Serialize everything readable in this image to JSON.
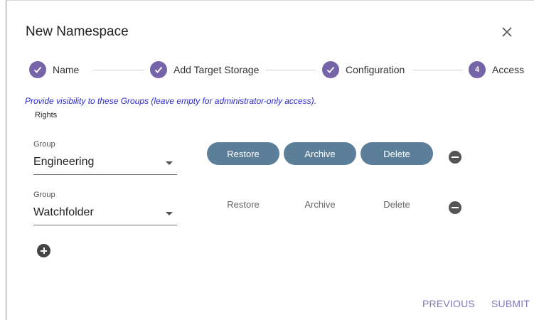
{
  "dialog": {
    "title": "New Namespace",
    "close_icon": "close-icon"
  },
  "stepper": {
    "steps": [
      {
        "label": "Name",
        "state": "complete",
        "icon": "check-icon"
      },
      {
        "label": "Add Target Storage",
        "state": "complete",
        "icon": "check-icon"
      },
      {
        "label": "Configuration",
        "state": "complete",
        "icon": "check-icon"
      },
      {
        "label": "Access",
        "state": "active",
        "number": "4"
      }
    ],
    "accent_color": "#7565a8"
  },
  "hint": "Provide visibility to these Groups (leave empty for administrator-only access).",
  "rights_header": "Rights",
  "rows": [
    {
      "group_label": "Group",
      "group_value": "Engineering",
      "rights": [
        {
          "label": "Restore",
          "selected": true
        },
        {
          "label": "Archive",
          "selected": true
        },
        {
          "label": "Delete",
          "selected": true
        }
      ]
    },
    {
      "group_label": "Group",
      "group_value": "Watchfolder",
      "rights": [
        {
          "label": "Restore",
          "selected": false
        },
        {
          "label": "Archive",
          "selected": false
        },
        {
          "label": "Delete",
          "selected": false
        }
      ]
    }
  ],
  "footer": {
    "previous_label": "PREVIOUS",
    "submit_label": "SUBMIT"
  },
  "colors": {
    "right_selected_bg": "#5c7f99",
    "link": "#8577b8",
    "hint": "#2a2ad0"
  }
}
